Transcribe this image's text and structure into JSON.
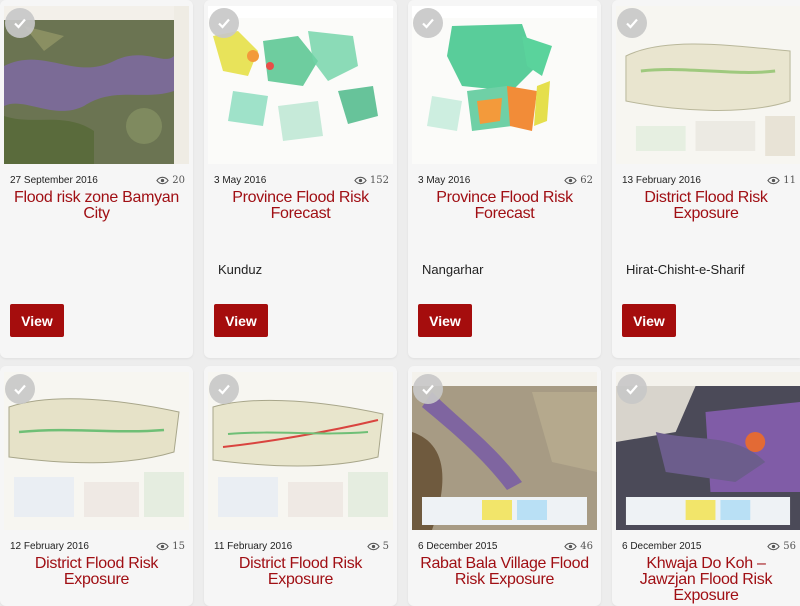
{
  "cards": [
    {
      "date": "27 September 2016",
      "views": "20",
      "title": "Flood risk zone Bamyan City",
      "subtitle": "",
      "button": "View"
    },
    {
      "date": "3 May 2016",
      "views": "152",
      "title": "Province Flood Risk Forecast",
      "subtitle": "Kunduz",
      "button": "View"
    },
    {
      "date": "3 May 2016",
      "views": "62",
      "title": "Province Flood Risk Forecast",
      "subtitle": "Nangarhar",
      "button": "View"
    },
    {
      "date": "13 February 2016",
      "views": "11",
      "title": "District Flood Risk Exposure",
      "subtitle": "Hirat-Chisht-e-Sharif",
      "button": "View"
    },
    {
      "date": "12 February 2016",
      "views": "15",
      "title": "District Flood Risk Exposure",
      "subtitle": "",
      "button": ""
    },
    {
      "date": "11 February 2016",
      "views": "5",
      "title": "District Flood Risk Exposure",
      "subtitle": "",
      "button": ""
    },
    {
      "date": "6 December 2015",
      "views": "46",
      "title": "Rabat Bala Village Flood Risk Exposure",
      "subtitle": "",
      "button": ""
    },
    {
      "date": "6 December 2015",
      "views": "56",
      "title": "Khwaja Do Koh – Jawzjan Flood Risk Exposure",
      "subtitle": "",
      "button": ""
    }
  ],
  "icons": {
    "selected": "check-icon",
    "views": "eye-icon"
  },
  "colors": {
    "title": "#a00f14",
    "button": "#a50d0d",
    "card": "#f6f6f6",
    "background": "#ededed"
  }
}
